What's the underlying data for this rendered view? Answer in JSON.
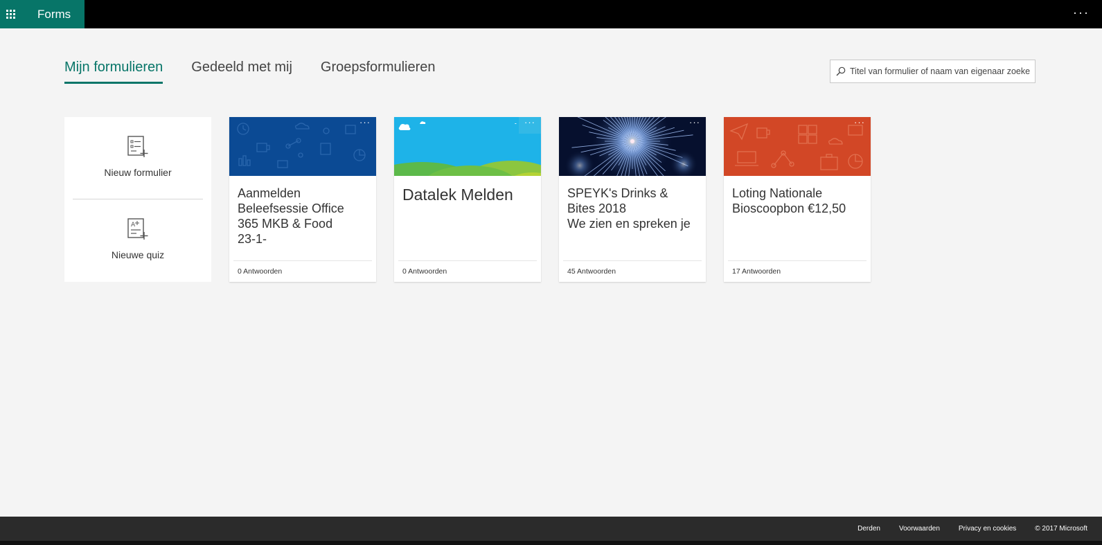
{
  "header": {
    "app_name": "Forms",
    "brand_color": "#077568",
    "more_label": "···"
  },
  "tabs": [
    {
      "label": "Mijn formulieren",
      "active": true
    },
    {
      "label": "Gedeeld met mij",
      "active": false
    },
    {
      "label": "Groepsformulieren",
      "active": false
    }
  ],
  "search": {
    "placeholder": "Titel van formulier of naam van eigenaar zoeken",
    "icon": "search-icon"
  },
  "new_actions": {
    "new_form": {
      "label": "Nieuw formulier",
      "icon": "new-form-icon"
    },
    "new_quiz": {
      "label": "Nieuwe quiz",
      "icon": "new-quiz-icon"
    }
  },
  "cards": [
    {
      "title": "Aanmelden Beleefsessie Office 365 MKB & Food                23-1-",
      "responses": "0 Antwoorden",
      "theme_color": "#0b4a94"
    },
    {
      "title": "Datalek Melden",
      "responses": "0 Antwoorden",
      "theme_color": "#1eb3e8"
    },
    {
      "title": "SPEYK's Drinks & Bites 2018\nWe zien en spreken je",
      "responses": "45 Antwoorden",
      "theme_color": "#06102e"
    },
    {
      "title": "Loting Nationale Bioscoopbon €12,50",
      "responses": "17 Antwoorden",
      "theme_color": "#d24726"
    }
  ],
  "card_more_label": "···",
  "footer": {
    "links": [
      "Derden",
      "Voorwaarden",
      "Privacy en cookies"
    ],
    "copyright": "© 2017 Microsoft"
  }
}
